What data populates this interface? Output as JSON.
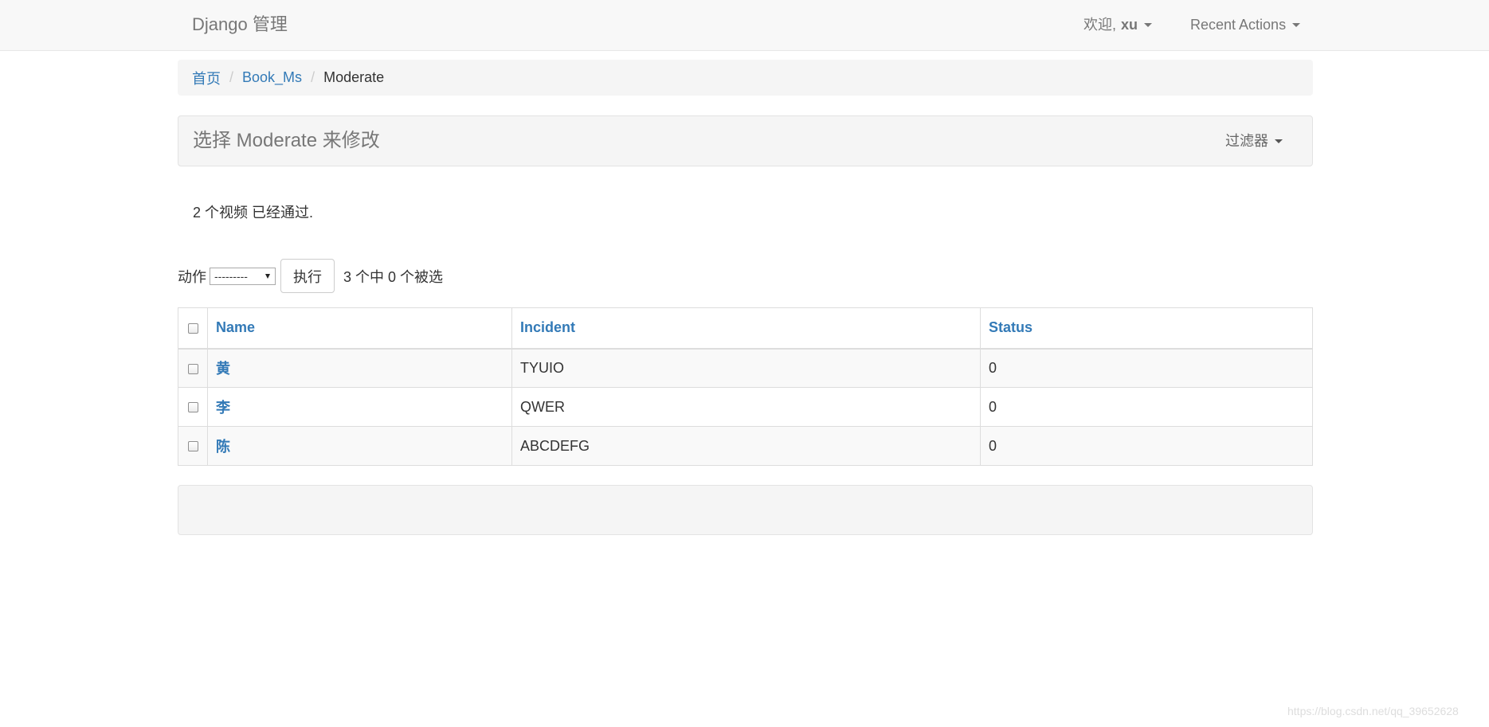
{
  "navbar": {
    "brand": "Django 管理",
    "welcome_label": "欢迎,",
    "username": "xu",
    "recent_actions": "Recent Actions"
  },
  "breadcrumb": {
    "home": "首页",
    "app": "Book_Ms",
    "current": "Moderate",
    "separator": "/"
  },
  "panel": {
    "title": "选择 Moderate 来修改",
    "filter_label": "过滤器"
  },
  "message": "2 个视频 已经通过.",
  "actions": {
    "label": "动作",
    "selected_option": "---------",
    "go_label": "执行",
    "selection_counter": "3 个中 0 个被选"
  },
  "table": {
    "headers": [
      "Name",
      "Incident",
      "Status"
    ],
    "rows": [
      {
        "name": "黄",
        "incident": "TYUIO",
        "status": "0"
      },
      {
        "name": "李",
        "incident": "QWER",
        "status": "0"
      },
      {
        "name": "陈",
        "incident": "ABCDEFG",
        "status": "0"
      }
    ]
  },
  "watermark": "https://blog.csdn.net/qq_39652628",
  "colors": {
    "link": "#337ab7",
    "navbar_bg": "#f8f8f8",
    "panel_bg": "#f5f5f5",
    "stripe": "#f9f9f9"
  },
  "icons": {
    "dropdown": "caret-down-icon",
    "checkbox": "checkbox-icon"
  }
}
